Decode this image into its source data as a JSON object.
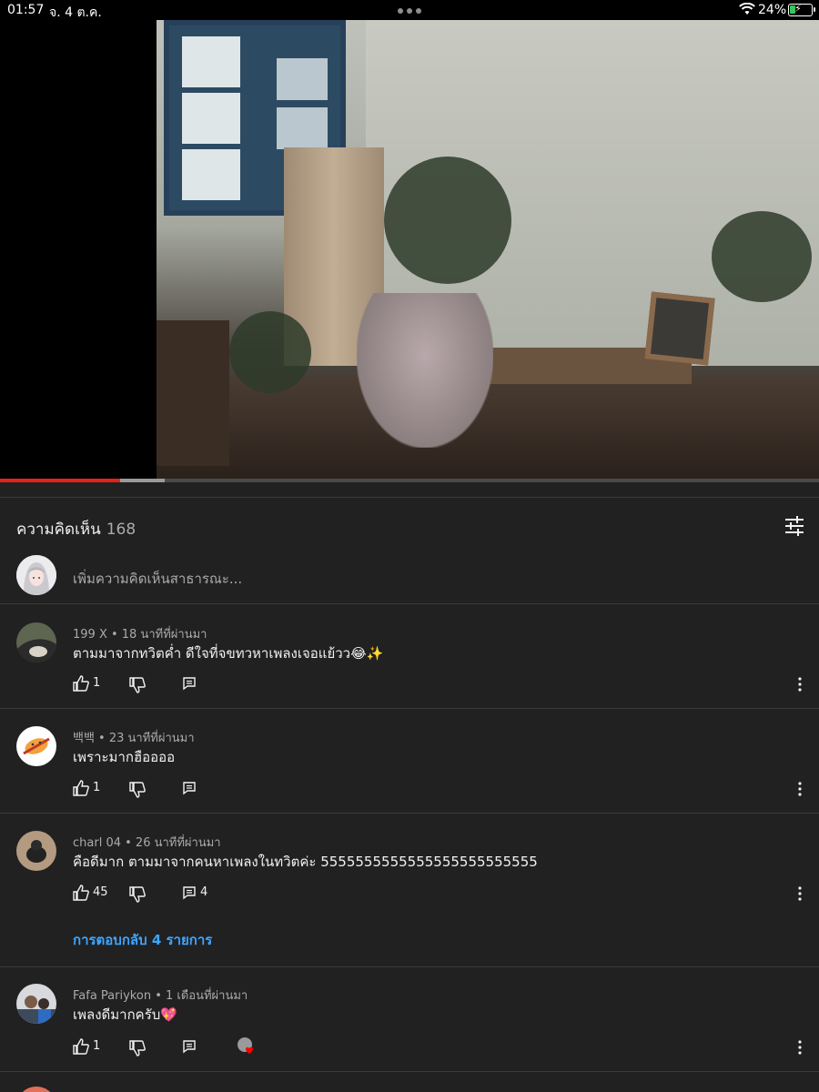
{
  "status": {
    "time": "01:57",
    "date": "จ. 4 ต.ค.",
    "battery": "24%"
  },
  "video": {
    "progress_played": 0.147,
    "progress_buffered": 0.201
  },
  "comments_section": {
    "title": "ความคิดเห็น",
    "count": "168",
    "add_placeholder": "เพิ่มความคิดเห็นสาธารณะ..."
  },
  "comments": [
    {
      "meta": "199 X • 18 นาทีที่ผ่านมา",
      "text": "ตามมาจากทวิตค่ำ ดีใจที่จขทวหาเพลงเจอแย้วว😂✨",
      "likes": "1",
      "replies": ""
    },
    {
      "meta": "백백 • 23 นาทีที่ผ่านมา",
      "text": "เพราะมากฮืออออ",
      "likes": "1",
      "replies": ""
    },
    {
      "meta": "charl 04 • 26 นาทีที่ผ่านมา",
      "text": "คือดีมาก ตามมาจากคนหาเพลงในทวิตค่ะ 5555555555555555555555555",
      "likes": "45",
      "replies": "4",
      "replies_link": "การตอบกลับ 4 รายการ"
    },
    {
      "meta": "Fafa Pariykon • 1 เดือนที่ผ่านมา",
      "text": "เพลงดีมากครับ💖",
      "likes": "1",
      "replies": ""
    }
  ],
  "colors": {
    "background": "#212121",
    "accent_link": "#3ea6ff",
    "progress": "#e62117"
  },
  "icons": [
    "wifi-icon",
    "battery-icon",
    "filter-icon",
    "like-icon",
    "dislike-icon",
    "reply-icon",
    "more-icon"
  ]
}
